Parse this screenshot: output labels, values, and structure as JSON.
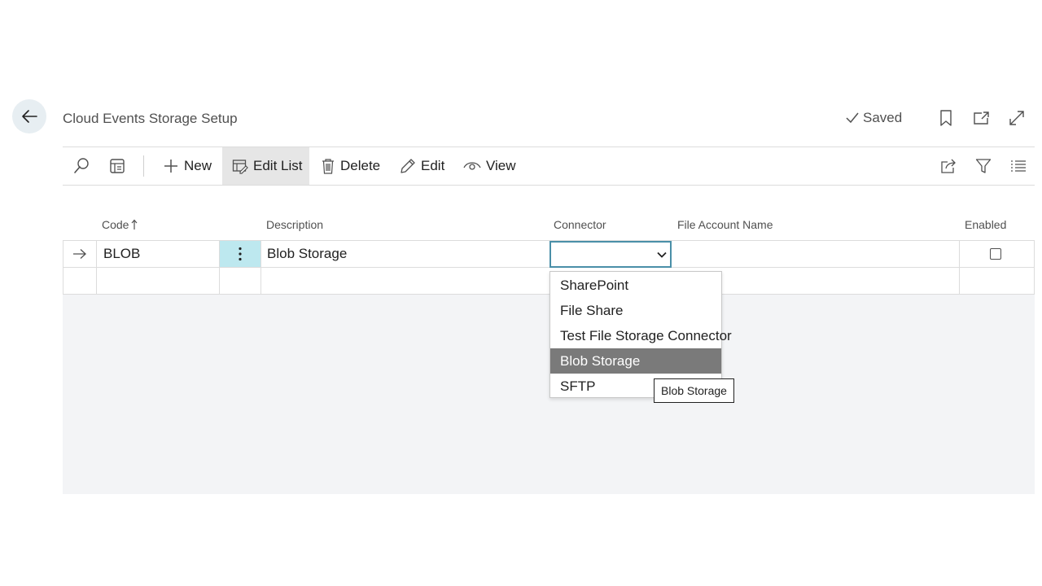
{
  "page": {
    "title": "Cloud Events Storage Setup",
    "saved_label": "Saved"
  },
  "icons": {
    "back": "back-arrow-icon",
    "saved": "checkmark-icon",
    "bookmark": "bookmark-icon",
    "open_new": "open-in-new-window-icon",
    "expand": "expand-icon",
    "search": "search-icon",
    "show_as_list": "list-view-icon",
    "new": "plus-icon",
    "edit_list": "edit-list-icon",
    "delete": "trash-icon",
    "edit": "pencil-icon",
    "view": "eye-icon",
    "share": "share-icon",
    "filter": "filter-icon",
    "list_options": "list-options-icon",
    "row_arrow": "arrow-right-icon",
    "row_menu": "more-vertical-icon",
    "sort_asc": "sort-ascending-icon",
    "dropdown": "chevron-down-icon"
  },
  "actions": {
    "new": "New",
    "edit_list": "Edit List",
    "delete": "Delete",
    "edit": "Edit",
    "view": "View"
  },
  "columns": {
    "code": "Code",
    "description": "Description",
    "connector": "Connector",
    "file_account_name": "File Account Name",
    "enabled": "Enabled"
  },
  "rows": [
    {
      "code": "BLOB",
      "description": "Blob Storage",
      "connector": "",
      "file_account_name": "",
      "enabled": false
    }
  ],
  "connector_options": [
    "SharePoint",
    "File Share",
    "Test File Storage Connector",
    "Blob Storage",
    "SFTP"
  ],
  "connector_highlighted": "Blob Storage",
  "tooltip": "Blob Storage",
  "colors": {
    "accent": "#4a8fa8",
    "selected_cell": "#bde8ef",
    "highlight": "#7a7a7a",
    "grid_bg": "#f3f4f6"
  }
}
